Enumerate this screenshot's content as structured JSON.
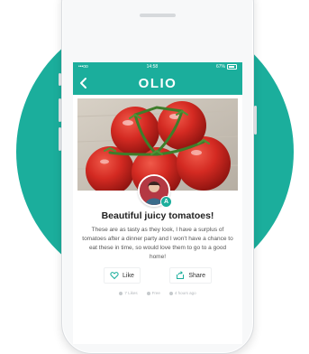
{
  "status_bar": {
    "carrier": "•••oo",
    "time": "14:58",
    "battery": "67%"
  },
  "header": {
    "app_name": "OLIO"
  },
  "listing": {
    "title": "Beautiful juicy tomatoes!",
    "description": "These are as tasty as they look, I have a surplus of tomatoes after a dinner party and I won't have a chance to eat these in time, so would love them to go to a good home!",
    "avatar_badge": "A",
    "like_label": "Like",
    "share_label": "Share",
    "meta": [
      "7 Likes",
      "Free",
      "4 hours ago"
    ]
  },
  "colors": {
    "accent": "#1bae9c",
    "tomato_red": "#c8211d"
  },
  "icons": [
    "back-arrow-icon",
    "heart-icon",
    "share-icon",
    "battery-icon"
  ]
}
